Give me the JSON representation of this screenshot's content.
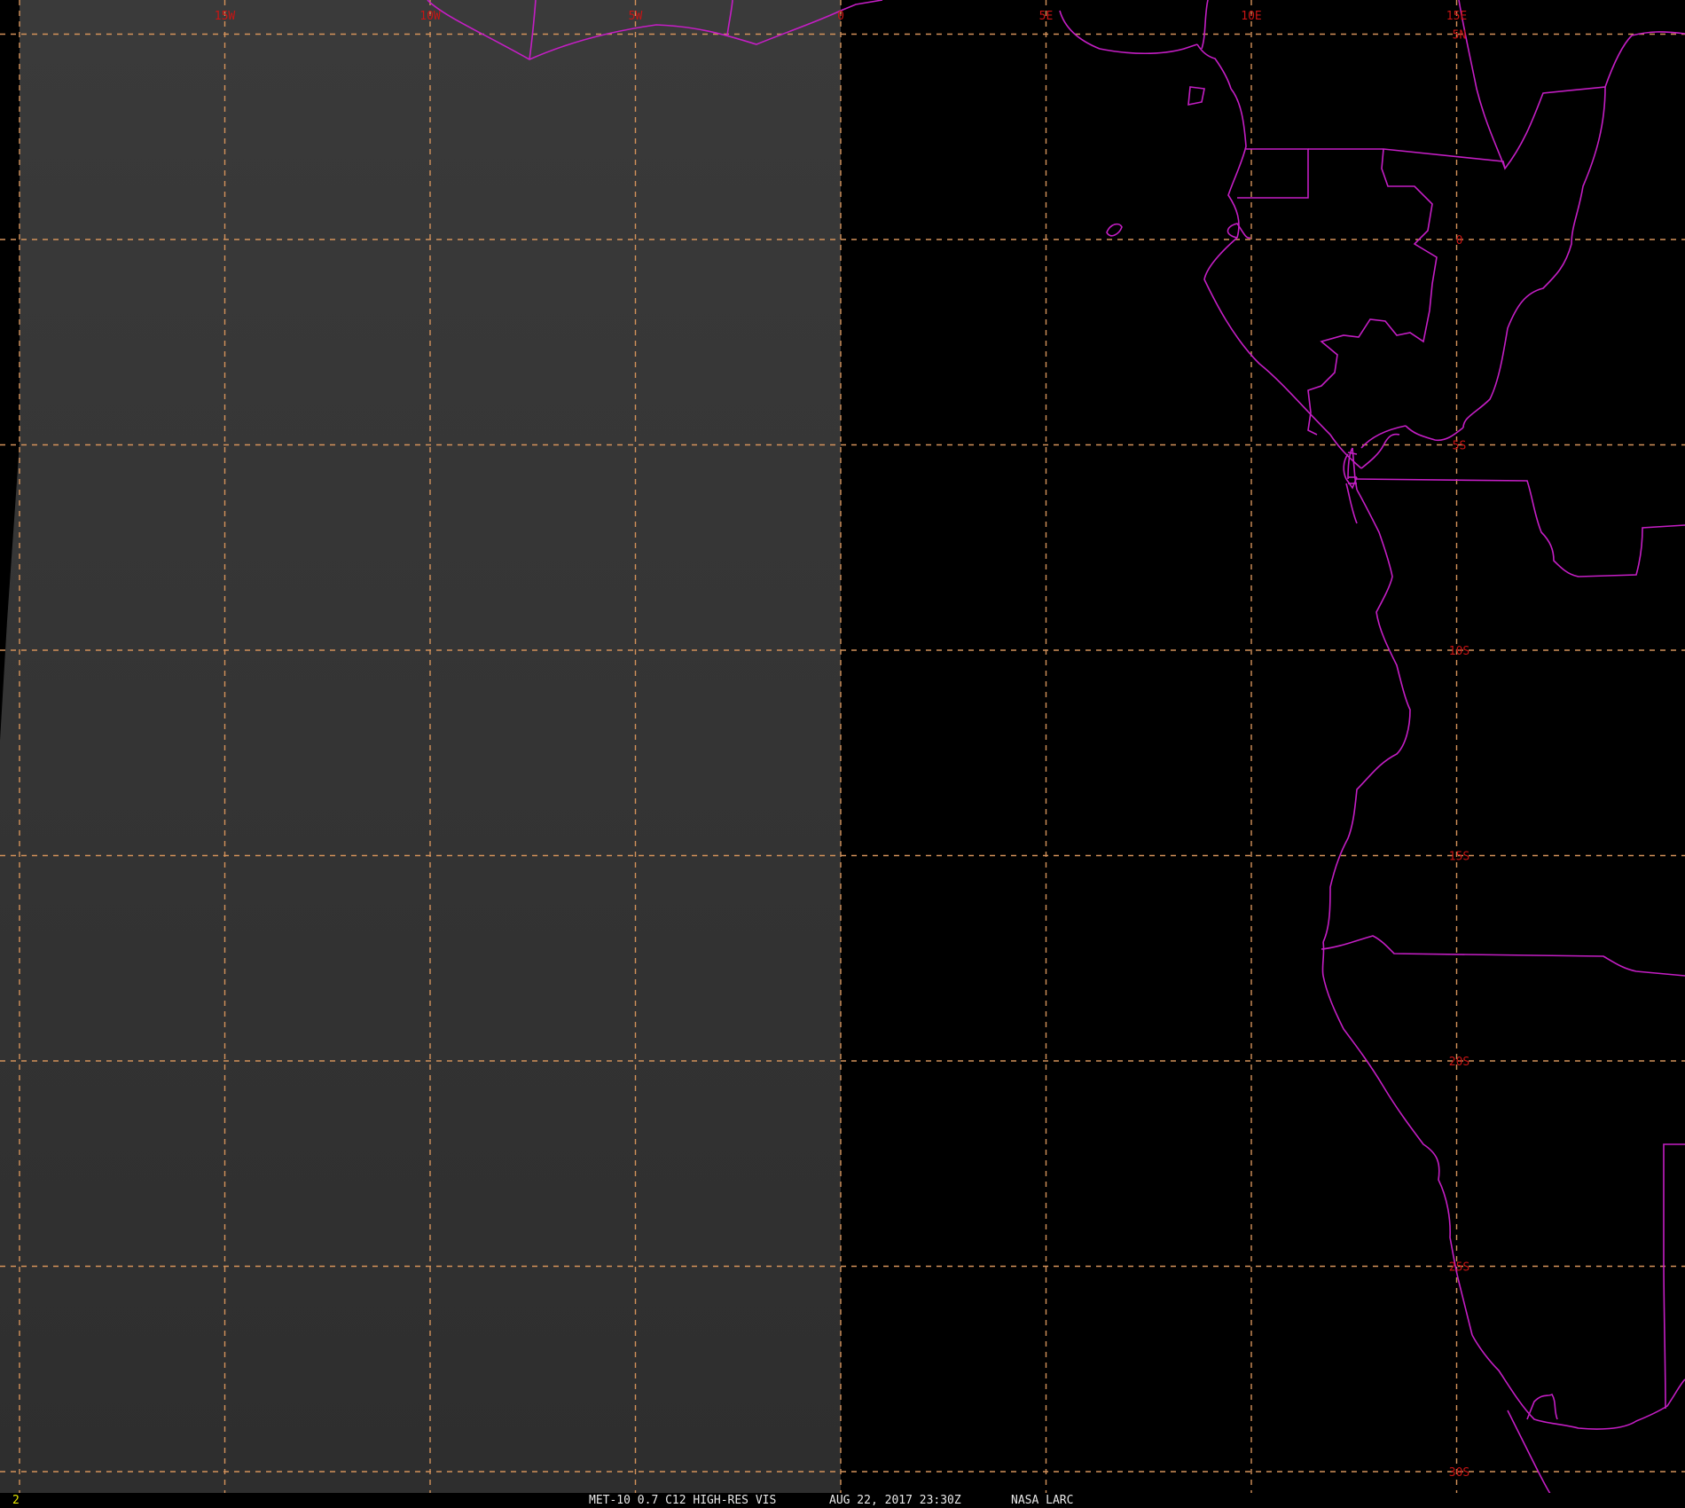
{
  "map": {
    "longitude_labels": [
      {
        "lon": -15,
        "text": "15W"
      },
      {
        "lon": -10,
        "text": "10W"
      },
      {
        "lon": -5,
        "text": "5W"
      },
      {
        "lon": 0,
        "text": "0"
      },
      {
        "lon": 5,
        "text": "5E"
      },
      {
        "lon": 10,
        "text": "10E"
      },
      {
        "lon": 15,
        "text": "15E"
      }
    ],
    "latitude_labels": [
      {
        "lat": 5,
        "text": "5N"
      },
      {
        "lat": 0,
        "text": "0"
      },
      {
        "lat": -5,
        "text": "5S"
      },
      {
        "lat": -10,
        "text": "10S"
      },
      {
        "lat": -15,
        "text": "15S"
      },
      {
        "lat": -20,
        "text": "20S"
      },
      {
        "lat": -25,
        "text": "25S"
      },
      {
        "lat": -30,
        "text": "30S"
      }
    ],
    "colors": {
      "background": "#000000",
      "imagery_panel": "#363636",
      "grid": "#d4925a",
      "coastline": "#c41ec4",
      "grid_labels": "#c81414",
      "footer_text": "#e8e8e8",
      "frame_number": "#e8e800"
    }
  },
  "footer": {
    "frame_number": "2",
    "product": "MET-10 0.7 C12 HIGH-RES VIS",
    "datetime": "AUG 22, 2017 23:30Z",
    "source": "NASA LARC"
  }
}
